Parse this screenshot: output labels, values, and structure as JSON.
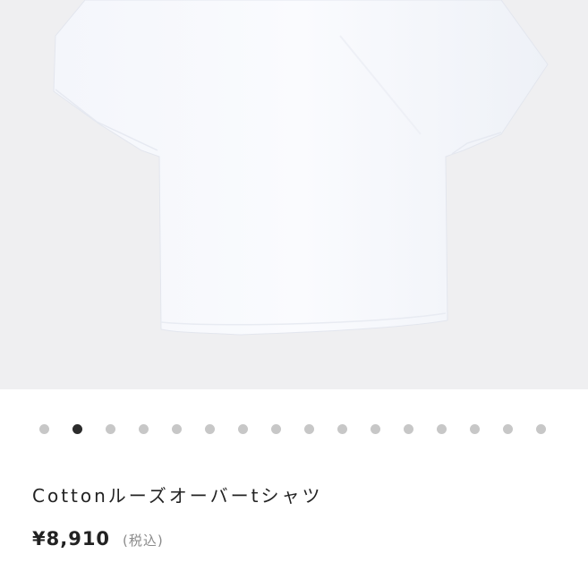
{
  "product": {
    "image_icon": "white-t-shirt-photo",
    "name": "Cottonルーズオーバーtシャツ",
    "price": "¥8,910",
    "tax_note": "(税込)"
  },
  "carousel": {
    "total": 16,
    "active_index": 1
  },
  "colors": {
    "image_background": "#efeff1",
    "dot_inactive": "#c7c7c7",
    "dot_active": "#2c2c2c",
    "text_primary": "#222222",
    "text_secondary": "#8a8a8a"
  }
}
